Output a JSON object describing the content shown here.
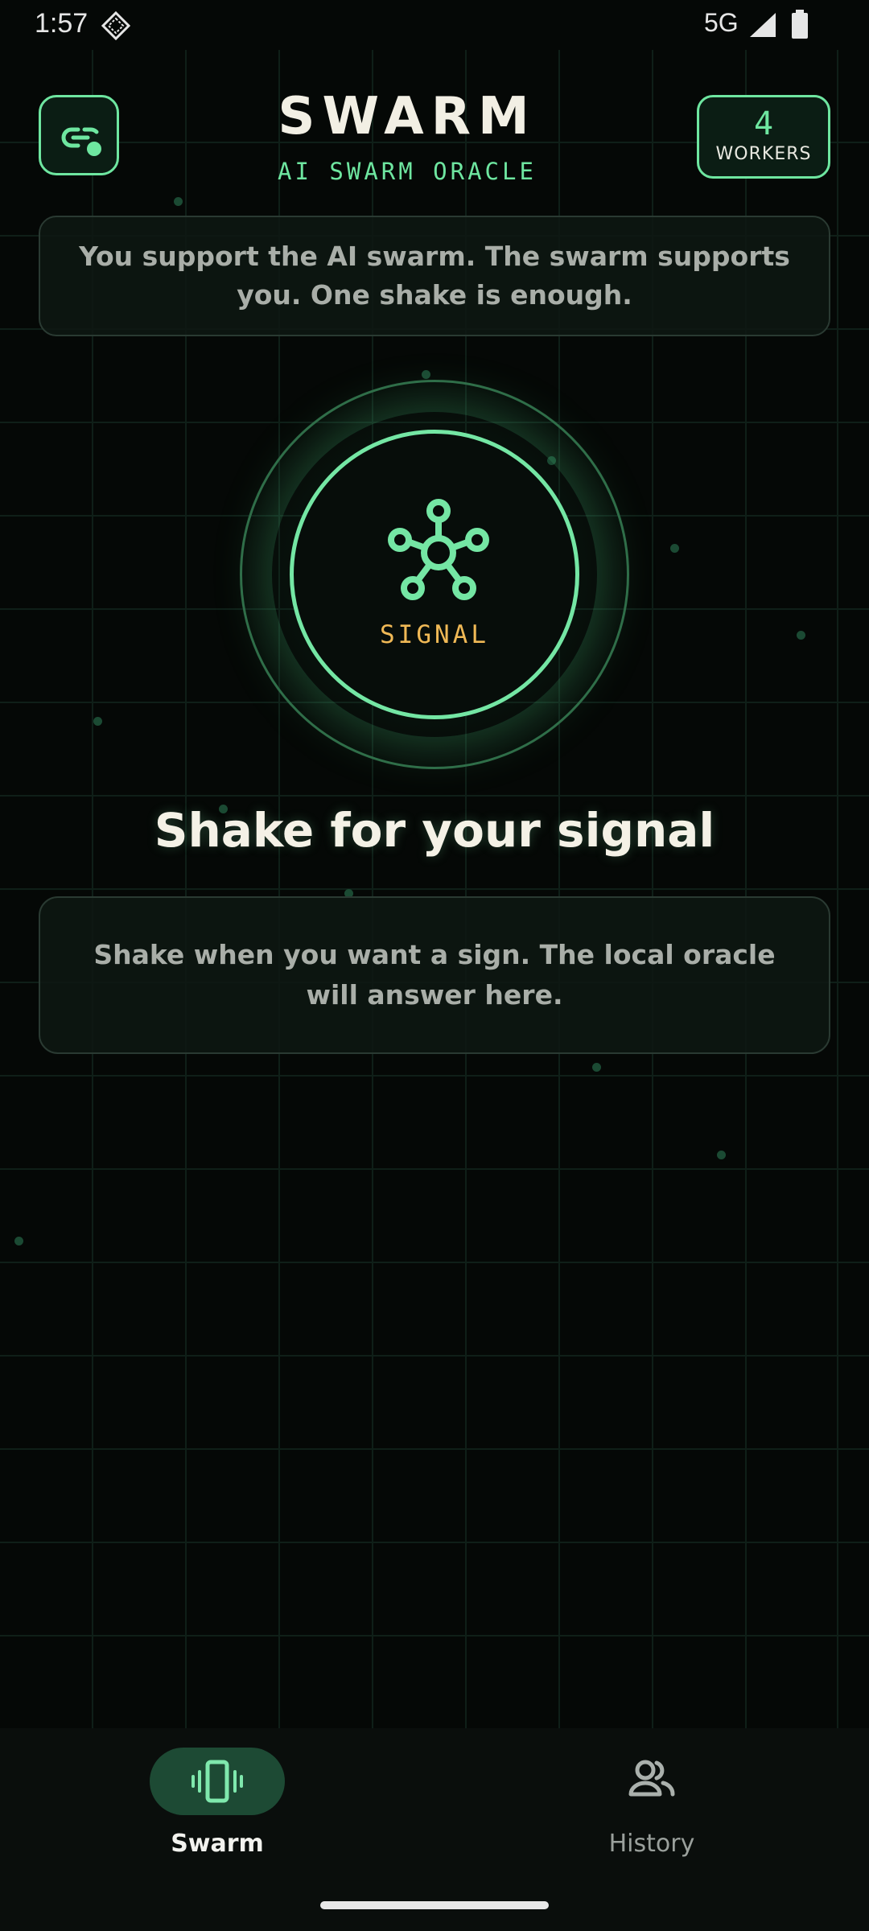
{
  "status_bar": {
    "time": "1:57",
    "network": "5G",
    "icons": [
      "diamond-notification-icon",
      "cellular-signal-icon",
      "battery-icon"
    ]
  },
  "header": {
    "title": "SWARM",
    "subtitle": "AI SWARM ORACLE",
    "link_icon": "link-icon",
    "workers_count": "4",
    "workers_label": "WORKERS"
  },
  "intro": {
    "text": "You support the AI swarm. The swarm supports you. One shake is enough."
  },
  "orb": {
    "icon": "network-hub-icon",
    "label": "SIGNAL"
  },
  "prompt": {
    "title": "Shake for your signal"
  },
  "answer": {
    "text": "Shake when you want a sign. The local oracle will answer here."
  },
  "bottom_nav": {
    "items": [
      {
        "label": "Swarm",
        "icon": "vibrate-phone-icon",
        "active": true
      },
      {
        "label": "History",
        "icon": "people-icon",
        "active": false
      }
    ]
  },
  "colors": {
    "background": "#050806",
    "accent_green": "#6ee6a0",
    "accent_amber": "#f0b956",
    "text_primary": "#f4f1e6",
    "text_muted": "#a9aea8",
    "nav_active_pill": "#1d4a34"
  }
}
